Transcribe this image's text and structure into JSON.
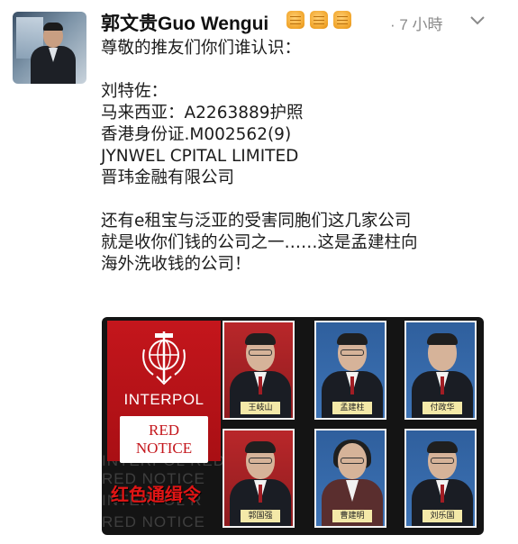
{
  "author": {
    "display_name": "郭文贵Guo Wengui",
    "emoji_count": 3,
    "timestamp": "· 7 小時"
  },
  "icons": {
    "avatar": "profile-photo",
    "emoji": "fist-emoji",
    "menu": "chevron-down-icon",
    "logo": "interpol-globe-logo"
  },
  "tweet": {
    "lines": [
      "尊敬的推友们你们谁认识：",
      "",
      "刘特佐：",
      "马来西亚：A2263889护照",
      "香港身份证.M002562(9)",
      "JYNWEL CPITAL LIMITED",
      "晋玮金融有限公司",
      "",
      "还有e租宝与泛亚的受害同胞们这几家公司",
      "就是收你们钱的公司之一……这是孟建柱向",
      "海外洗收钱的公司！"
    ]
  },
  "media": {
    "interpol_word": "INTERPOL",
    "red_notice_line1": "RED",
    "red_notice_line2": "NOTICE",
    "title_cn": "红色通缉令",
    "watermark_lines": [
      "INTERPOL RED NOTICE",
      "RED NOTICE",
      "INTERPOL R",
      "RED NOTICE"
    ],
    "portraits": [
      {
        "caption": "王岐山"
      },
      {
        "caption": "孟建柱"
      },
      {
        "caption": "付政华"
      },
      {
        "caption": "郭国强"
      },
      {
        "caption": "曹建明"
      },
      {
        "caption": "刘乐国"
      }
    ]
  },
  "colors": {
    "interpol_red": "#c4161c",
    "caption_bg": "#f4e9a8",
    "time_gray": "#8a8a8a"
  }
}
